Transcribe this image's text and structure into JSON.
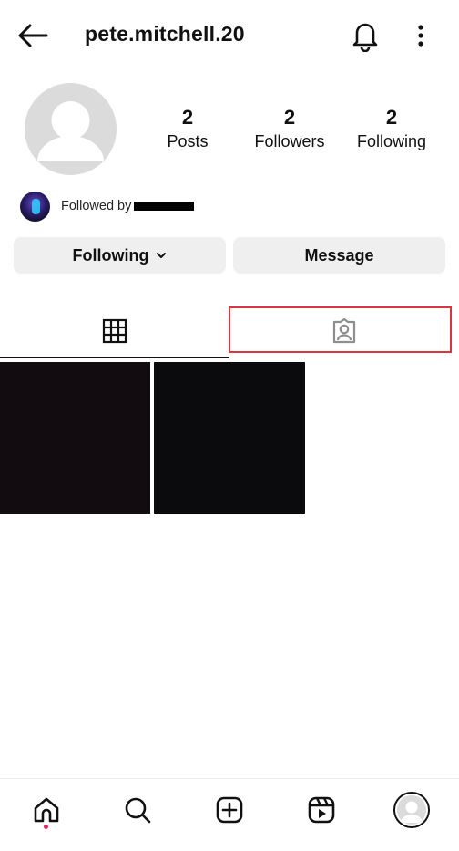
{
  "header": {
    "username": "pete.mitchell.20",
    "icons": {
      "back": "arrow-left-icon",
      "notifications": "bell-icon",
      "more": "more-vertical-icon"
    }
  },
  "profile": {
    "stats": [
      {
        "value": "2",
        "label": "Posts"
      },
      {
        "value": "2",
        "label": "Followers"
      },
      {
        "value": "2",
        "label": "Following"
      }
    ],
    "followed_by_label": "Followed by"
  },
  "actions": {
    "following_label": "Following",
    "message_label": "Message"
  },
  "tabs": [
    {
      "icon": "grid-icon",
      "active": true
    },
    {
      "icon": "tagged-person-icon",
      "active": false,
      "highlighted": true
    }
  ],
  "posts": [
    {
      "color": "#120c10"
    },
    {
      "color": "#0b0b0d"
    }
  ],
  "bottom_nav": [
    {
      "icon": "home-icon",
      "active": true
    },
    {
      "icon": "search-icon"
    },
    {
      "icon": "create-icon"
    },
    {
      "icon": "reels-icon"
    },
    {
      "icon": "profile-avatar-icon"
    }
  ],
  "colors": {
    "highlight": "#d9363e",
    "button_bg": "#efefef",
    "notification_dot": "#e0245e"
  }
}
